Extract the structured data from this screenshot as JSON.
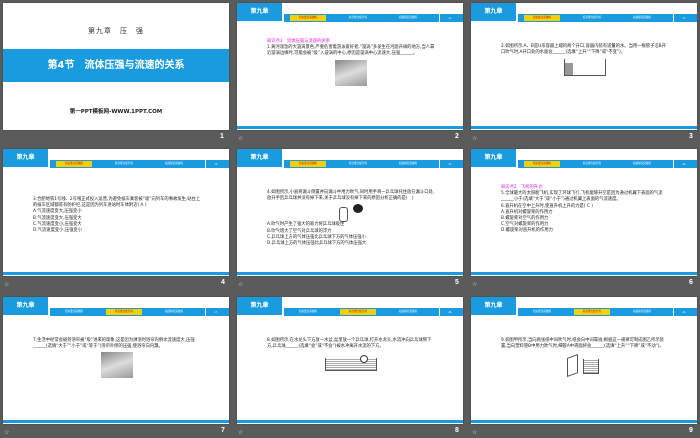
{
  "title_slide": {
    "chapter": "第九章　压　强",
    "section": "第4节　流体压强与流速的关系",
    "site": "第一PPT模板网-WWW.1PPT.COM",
    "number": "1"
  },
  "accent_color": "#1a9be0",
  "highlight_color": "#f5d000",
  "header": {
    "chapter": "第九章",
    "tabs": [
      "知识要点基础练",
      "综合能力提升练",
      "拓展探究突破练"
    ]
  },
  "animation_icon": "star-icon",
  "slides": [
    {
      "number": "2",
      "page": "-2-",
      "active_tab": 0,
      "heading": "知识点1　流体压强与流速的关系",
      "lines": [
        "1.黄河湍急的大漩涡景色,严重危害着游泳爱好者,“漩涡”多发生在河面开阔的地方,当人靠近漩涡边缘时,可能会被“吸”入漩涡的中心,原因是漩涡中心流速大,压强______。"
      ],
      "figure": "photo"
    },
    {
      "number": "3",
      "page": "-3-",
      "active_tab": 0,
      "lines": [
        "2.如图所示,A、B是U形容器上端的两个开口,容器内装有适量的水。当用一根管子沿B开口吹气时,A开口处的水面会______(选填“上升”“下降”或“不变”)。"
      ],
      "figure": "u-tube"
    },
    {
      "number": "4",
      "page": "-4-",
      "active_tab": 0,
      "lines": [
        "3.合肥地铁1号线、2号线正式投入运营,为避免候车乘客被“吸”向列车的事故发生,站台上的候车区域都装有防护栏,这是因为列车进站时车体附近( A )",
        "A.气流速度变大,压强变小",
        "B.气流速度变大,压强变大",
        "C.气流速度变小,压强变大",
        "D.气流速度变小,压强变小"
      ]
    },
    {
      "number": "5",
      "page": "-5-",
      "active_tab": 0,
      "lines": [
        "4.如图所示,小丽将漏斗倒置并向漏斗中用力吹气,同时用手将一乒乓球托住放在漏斗口处,放开手后乒乓球并没有掉下来,关于乒乓球没有掉下来的原因分析正确的是(　)"
      ],
      "figure": "funnel",
      "after": [
        "A.吹气时产生了强大的吸力将乒乓球吸住",
        "B.吹气增大了空气对乒乓球的浮力",
        "C.乒乓球上方的气体压强比乒乓球下方的气体压强小",
        "D.乒乓球上方的气体压强比乒乓球下方的气体压强大"
      ]
    },
    {
      "number": "6",
      "page": "-6-",
      "active_tab": 0,
      "heading": "知识点2　飞机的升力",
      "lines": [
        "5.全球最大的太阳能飞机,实现了环球飞行,飞机能够升空是因为通过机翼下表面的气流______小于(选填“大于”或“小于”)通过机翼上表面的气流速度。",
        "6.直升机在空中上升时,使直升机上升的力是( C )",
        "A.直升机对螺旋桨的作用力",
        "B.螺旋桨对空气的作用力",
        "C.空气对螺旋桨的作用力",
        "D.螺旋桨对直升机的作用力"
      ]
    },
    {
      "number": "7",
      "page": "-7-",
      "active_tab": 1,
      "lines": [
        "7.生活中经常会碰到浴帘被“吸”进来的现象,这是因为淋浴时浴帘内侧水流速度大,压强______(选填“大于”“小于”或“等于”)浴帘外侧的压强,使浴帘向内飘。"
      ],
      "figure": "photo"
    },
    {
      "number": "8",
      "page": "-8-",
      "active_tab": 1,
      "lines": [
        "8.如图所示,在水龙头下方放一水盆,盆里放一个乒乓球,打开水龙头,水流冲向乒乓球侧下方,乒乓球______(选填“会”或“不会”)被水冲离开水流的下方。"
      ],
      "figure": "basin"
    },
    {
      "number": "9",
      "page": "-9-",
      "active_tab": 1,
      "lines": [
        "9.如图甲所示,当向两张纸中间吹气时,纸会向中间靠拢;根据这一规律可制成图乙所示装置,当向塑料管B中用力吹气时,细管A中液面将会______(选填“上升”“下降”或“不动”)。"
      ],
      "figure": "papers"
    }
  ]
}
